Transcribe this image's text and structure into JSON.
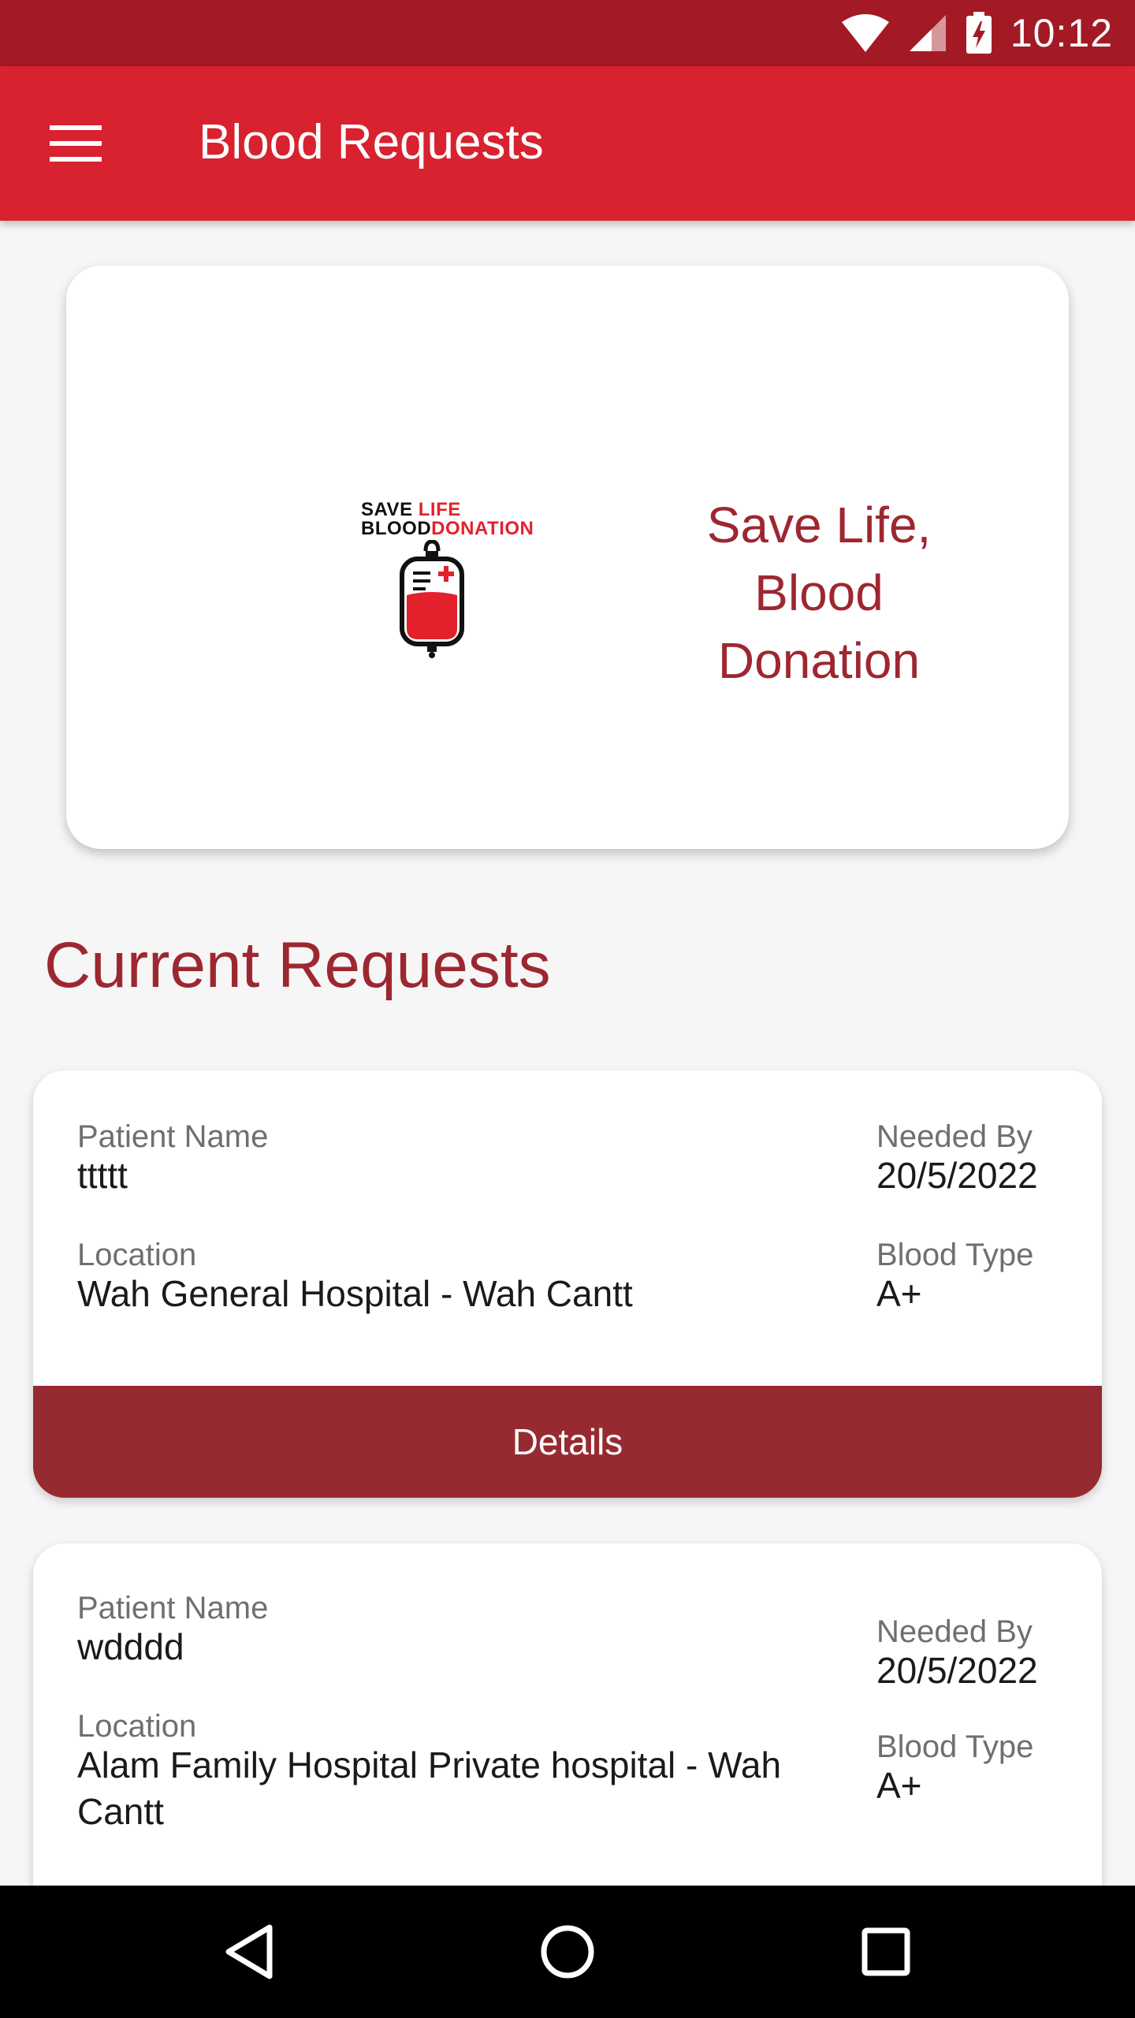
{
  "status_bar": {
    "time": "10:12",
    "icons": [
      "wifi-icon",
      "cell-signal-icon",
      "battery-charging-icon"
    ]
  },
  "app_bar": {
    "title": "Blood Requests",
    "menu_icon": "menu-icon"
  },
  "banner": {
    "logo_line1_black": "SAVE ",
    "logo_line1_red": "LIFE",
    "logo_line2_black": "BLOOD",
    "logo_line2_red": "DONATION",
    "text_line1": "Save Life,",
    "text_line2": "Blood Donation"
  },
  "section_title": "Current Requests",
  "requests": [
    {
      "patient_label": "Patient Name",
      "patient_name": "ttttt",
      "location_label": "Location",
      "location": "Wah General Hospital - Wah Cantt",
      "needed_by_label": "Needed By",
      "needed_by": "20/5/2022",
      "blood_type_label": "Blood Type",
      "blood_type": "A+",
      "details_label": "Details"
    },
    {
      "patient_label": "Patient Name",
      "patient_name": "wdddd",
      "location_label": "Location",
      "location_line1": "Alam Family Hospital Private hospital -  Wah",
      "location_line2": "Cantt",
      "needed_by_label": "Needed By",
      "needed_by": "20/5/2022",
      "blood_type_label": "Blood Type",
      "blood_type": "A+"
    }
  ],
  "nav_bar": {
    "icons": [
      "back-icon",
      "home-icon",
      "recents-icon"
    ]
  },
  "colors": {
    "status_bar": "#a31a24",
    "app_bar": "#d8222f",
    "accent_text": "#9d2730",
    "details_button": "#972a31"
  }
}
